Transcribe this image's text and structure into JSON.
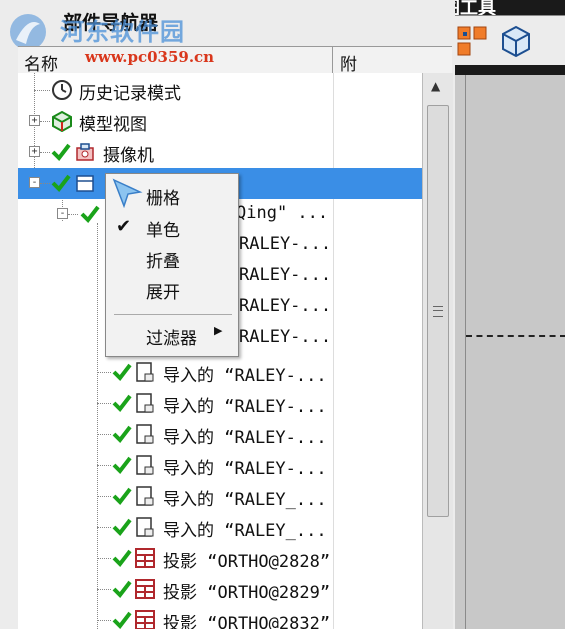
{
  "window": {
    "panel_title": "部件导航器",
    "toolbar_window_title": "标准工程图工具"
  },
  "watermark": {
    "text": "河东软件园",
    "url": "www.pc0359.cn"
  },
  "columns": {
    "name": "名称",
    "dependency": "附"
  },
  "toolbar": {
    "buttons": [
      {
        "icon": "new-sheet-icon"
      },
      {
        "icon": "base-view-icon"
      },
      {
        "icon": "projected-view-icon"
      },
      {
        "icon": "cube-view-icon"
      }
    ]
  },
  "tree": {
    "rows": [
      {
        "label": "历史记录模式",
        "icon": "clock-icon",
        "checked": false,
        "expander": ""
      },
      {
        "label": "模型视图",
        "icon": "model-views-icon",
        "checked": false,
        "expander": "+"
      },
      {
        "label": "摄像机",
        "icon": "camera-icon",
        "checked": true,
        "expander": "+"
      },
      {
        "label": "",
        "icon": "drawing-icon",
        "checked": true,
        "expander": "-",
        "selected": true
      },
      {
        "label": "Qing\" ...",
        "icon": "",
        "checked": true,
        "expander": "-"
      },
      {
        "label": "RALEY-...",
        "icon": "",
        "checked": false,
        "expander": ""
      },
      {
        "label": "RALEY-...",
        "icon": "",
        "checked": false,
        "expander": ""
      },
      {
        "label": "RALEY-...",
        "icon": "",
        "checked": false,
        "expander": ""
      },
      {
        "label": "RALEY-...",
        "icon": "",
        "checked": false,
        "expander": ""
      },
      {
        "label": "导入的 “RALEY-...",
        "icon": "imported-view-icon",
        "checked": true,
        "expander": ""
      },
      {
        "label": "导入的 “RALEY-...",
        "icon": "imported-view-icon",
        "checked": true,
        "expander": ""
      },
      {
        "label": "导入的 “RALEY-...",
        "icon": "imported-view-icon",
        "checked": true,
        "expander": ""
      },
      {
        "label": "导入的 “RALEY-...",
        "icon": "imported-view-icon",
        "checked": true,
        "expander": ""
      },
      {
        "label": "导入的 “RALEY_...",
        "icon": "imported-view-icon",
        "checked": true,
        "expander": ""
      },
      {
        "label": "导入的 “RALEY_...",
        "icon": "imported-view-icon",
        "checked": true,
        "expander": ""
      },
      {
        "label": "投影 “ORTHO@2828”",
        "icon": "projection-icon",
        "checked": true,
        "expander": ""
      },
      {
        "label": "投影 “ORTHO@2829”",
        "icon": "projection-icon",
        "checked": true,
        "expander": ""
      },
      {
        "label": "投影 “ORTHO@2832”",
        "icon": "projection-icon",
        "checked": true,
        "expander": ""
      }
    ]
  },
  "context_menu": {
    "items": [
      {
        "label": "栅格",
        "checked": false
      },
      {
        "label": "单色",
        "checked": true
      },
      {
        "label": "折叠",
        "checked": false
      },
      {
        "label": "展开",
        "checked": false
      }
    ],
    "filter_label": "过滤器"
  },
  "colors": {
    "selection": "#3a8ee6",
    "check_green": "#1aa31a",
    "panel_bg": "#ececec",
    "toolbar_bar": "#1a1a1a"
  }
}
